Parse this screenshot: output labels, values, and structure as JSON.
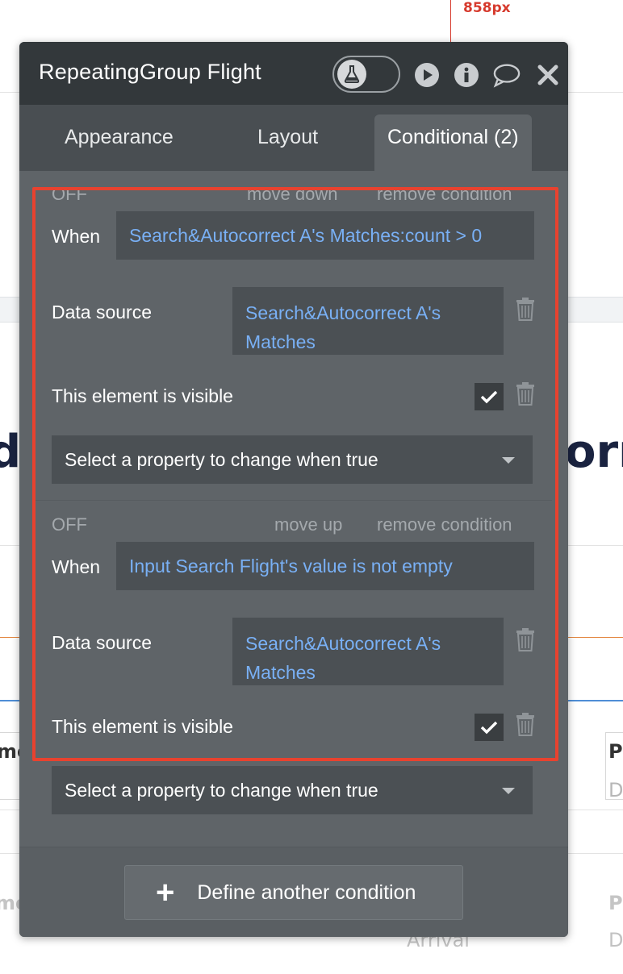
{
  "canvas": {
    "ruler_label": "858px",
    "bg_fragments": {
      "left_big": "ds",
      "right_big": "orm",
      "left_col_1": "me",
      "right_col_1": "P",
      "right_col_2": "D",
      "left_col_2": "me",
      "right_col_3": "P",
      "arrival": "Arrival",
      "right_col_4": "D"
    }
  },
  "panel": {
    "title": "RepeatingGroup Flight",
    "icons": [
      "flask-icon",
      "play-icon",
      "info-icon",
      "comment-icon",
      "close-icon"
    ],
    "tabs": [
      {
        "label": "Appearance",
        "active": false
      },
      {
        "label": "Layout",
        "active": false
      },
      {
        "label": "Conditional (2)",
        "active": true
      }
    ],
    "conditions": [
      {
        "status": "OFF",
        "move_label": "move down",
        "remove_label": "remove condition",
        "when_label": "When",
        "when_value": "Search&Autocorrect A's Matches:count > 0",
        "data_source_label": "Data source",
        "data_source_value_line1": "Search&Autocorrect A's",
        "data_source_value_line2": "Matches",
        "visible_label": "This element is visible",
        "visible_checked": true,
        "select_placeholder": "Select a property to change when true"
      },
      {
        "status": "OFF",
        "move_label": "move up",
        "remove_label": "remove condition",
        "when_label": "When",
        "when_value": "Input Search Flight's value is not empty",
        "data_source_label": "Data source",
        "data_source_value_line1": "Search&Autocorrect A's",
        "data_source_value_line2": "Matches",
        "visible_label": "This element is visible",
        "visible_checked": true,
        "select_placeholder": "Select a property to change when true"
      }
    ],
    "define_button_label": "Define another condition"
  },
  "colors": {
    "panel_bg": "#5f6468",
    "titlebar_bg": "#33383b",
    "link_blue": "#79b0f5",
    "highlight_red": "#e8422f"
  }
}
